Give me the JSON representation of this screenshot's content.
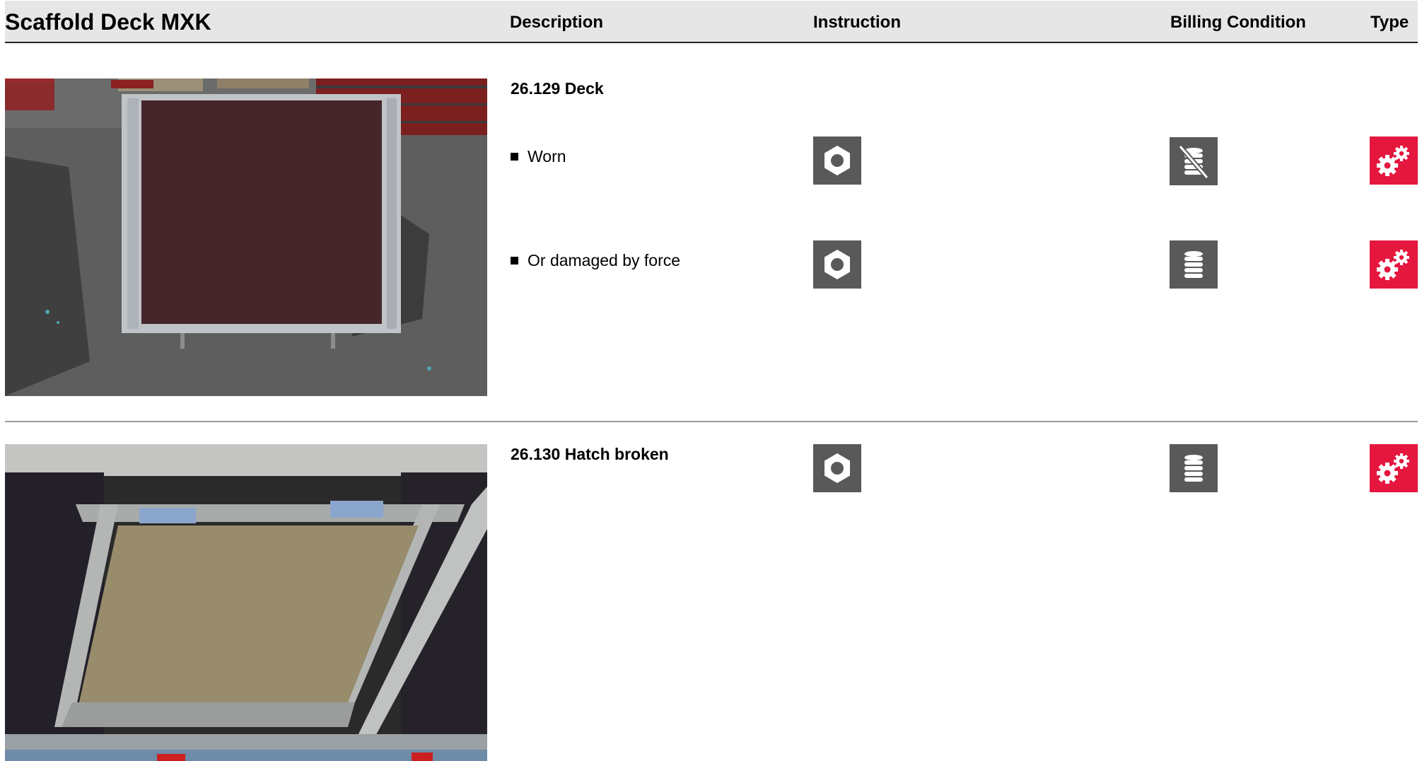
{
  "header": {
    "title": "Scaffold Deck MXK",
    "description": "Description",
    "instruction": "Instruction",
    "billing_condition": "Billing Condition",
    "type": "Type"
  },
  "items": [
    {
      "title": "26.129 Deck",
      "conditions": [
        {
          "label": "Worn",
          "instruction_icon": "nut-icon",
          "billing_icon": "coins-crossed-icon",
          "type_icon": "gears-icon"
        },
        {
          "label": "Or damaged by force",
          "instruction_icon": "nut-icon",
          "billing_icon": "coins-icon",
          "type_icon": "gears-icon"
        }
      ]
    },
    {
      "title": "26.130 Hatch broken",
      "instruction_icon": "nut-icon",
      "billing_icon": "coins-icon",
      "type_icon": "gears-icon"
    }
  ],
  "colors": {
    "icon_gray": "#595959",
    "type_red": "#e5173f",
    "header_bg": "#e6e6e6"
  }
}
